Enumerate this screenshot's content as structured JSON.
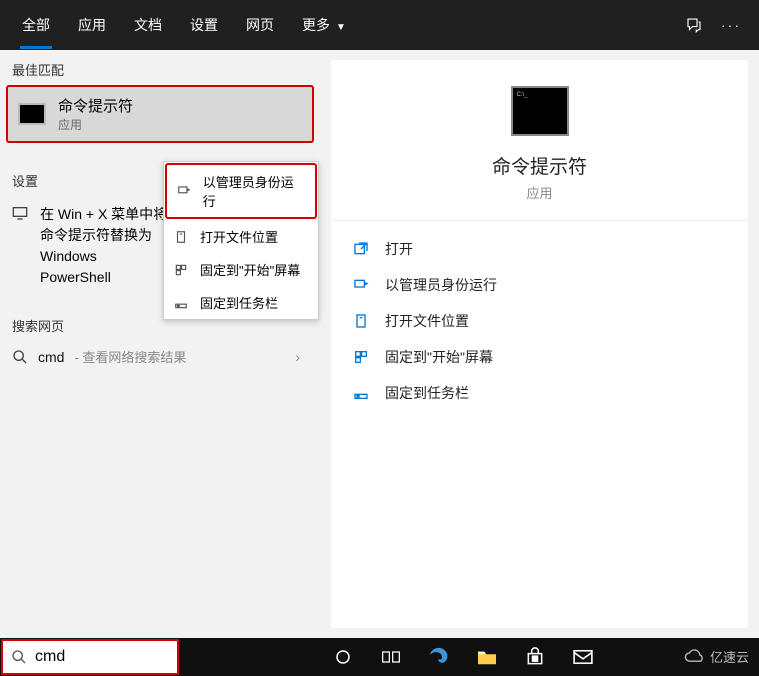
{
  "tabs": {
    "all": "全部",
    "apps": "应用",
    "docs": "文档",
    "settings": "设置",
    "web": "网页",
    "more": "更多"
  },
  "left": {
    "best_match_label": "最佳匹配",
    "best_match": {
      "title": "命令提示符",
      "sub": "应用"
    },
    "settings_label": "设置",
    "settings_item": "在 Win + X 菜单中将命令提示符替换为 Windows PowerShell",
    "web_label": "搜索网页",
    "web_query": "cmd",
    "web_hint": " - 查看网络搜索结果"
  },
  "context_menu": {
    "run_admin": "以管理员身份运行",
    "open_location": "打开文件位置",
    "pin_start": "固定到\"开始\"屏幕",
    "pin_taskbar": "固定到任务栏"
  },
  "preview": {
    "title": "命令提示符",
    "sub": "应用",
    "actions": {
      "open": "打开",
      "run_admin": "以管理员身份运行",
      "open_location": "打开文件位置",
      "pin_start": "固定到\"开始\"屏幕",
      "pin_taskbar": "固定到任务栏"
    }
  },
  "search": {
    "value": "cmd"
  },
  "watermark": "亿速云"
}
